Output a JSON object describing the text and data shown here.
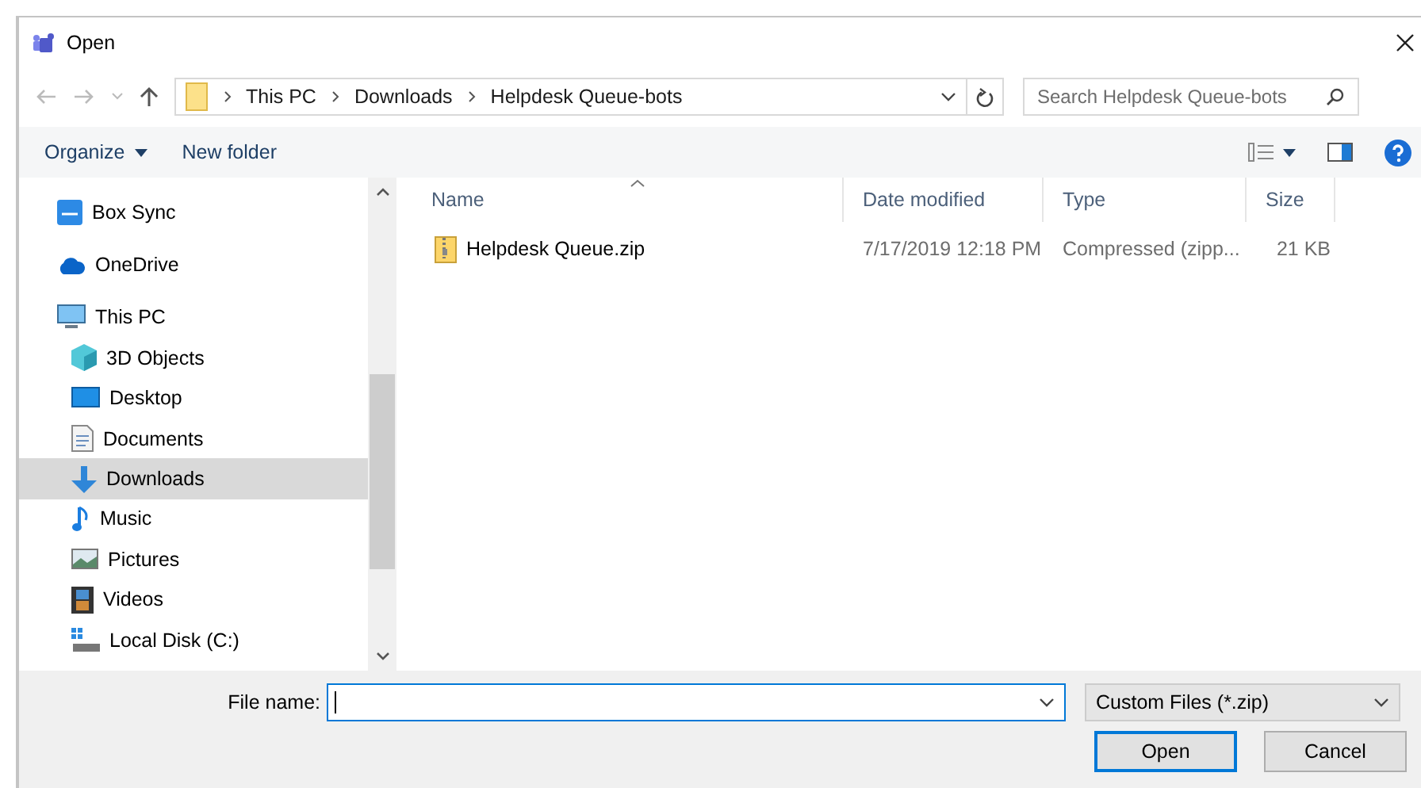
{
  "window": {
    "title": "Open"
  },
  "address": {
    "path": [
      "This PC",
      "Downloads",
      "Helpdesk Queue-bots"
    ]
  },
  "search": {
    "placeholder": "Search Helpdesk Queue-bots"
  },
  "toolbar": {
    "organize": "Organize",
    "new_folder": "New folder"
  },
  "sidebar": {
    "items": [
      {
        "label": "Box Sync",
        "selected": false
      },
      {
        "label": "OneDrive",
        "selected": false
      },
      {
        "label": "This PC",
        "selected": false,
        "children": [
          {
            "label": "3D Objects",
            "selected": false
          },
          {
            "label": "Desktop",
            "selected": false
          },
          {
            "label": "Documents",
            "selected": false
          },
          {
            "label": "Downloads",
            "selected": true
          },
          {
            "label": "Music",
            "selected": false
          },
          {
            "label": "Pictures",
            "selected": false
          },
          {
            "label": "Videos",
            "selected": false
          },
          {
            "label": "Local Disk (C:)",
            "selected": false
          }
        ]
      }
    ]
  },
  "table": {
    "columns": [
      "Name",
      "Date modified",
      "Type",
      "Size"
    ],
    "rows": [
      {
        "name": "Helpdesk Queue.zip",
        "date": "7/17/2019 12:18 PM",
        "type": "Compressed (zipp...",
        "size": "21 KB",
        "selected": false
      }
    ]
  },
  "file_name": {
    "label": "File name:"
  },
  "file_type": {
    "value": "Custom Files (*.zip)"
  },
  "buttons": [
    {
      "label": "Open",
      "default": true
    },
    {
      "label": "Cancel",
      "default": false
    }
  ]
}
